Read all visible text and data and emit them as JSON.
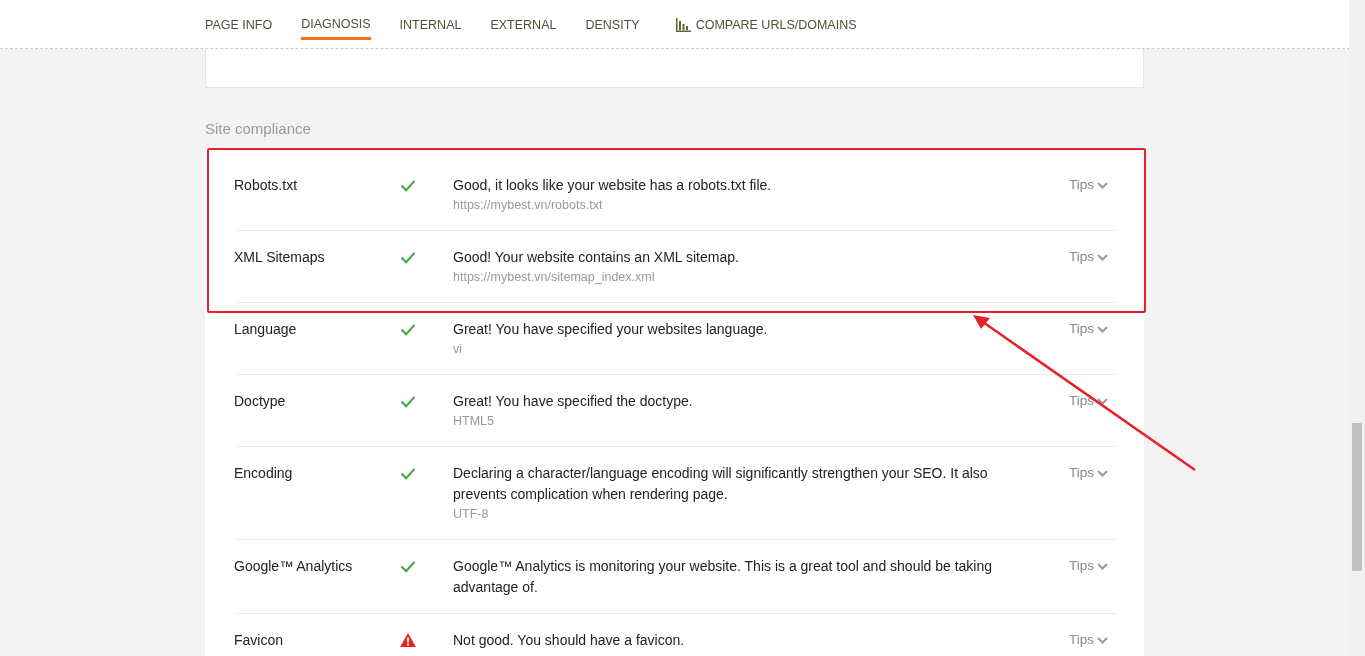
{
  "tabs": [
    {
      "label": "PAGE INFO",
      "selected": false
    },
    {
      "label": "DIAGNOSIS",
      "selected": true
    },
    {
      "label": "INTERNAL",
      "selected": false
    },
    {
      "label": "EXTERNAL",
      "selected": false
    },
    {
      "label": "DENSITY",
      "selected": false
    },
    {
      "label": "COMPARE URLS/DOMAINS",
      "selected": false,
      "kind": "chart"
    }
  ],
  "section": {
    "title": "Site compliance",
    "rows": [
      {
        "name": "Robots.txt",
        "kind": "pass",
        "message": "Good, it looks like your website has a robots.txt file.",
        "detail": "https://mybest.vn/robots.txt",
        "tips": "Tips"
      },
      {
        "name": "XML Sitemaps",
        "kind": "pass",
        "message": "Good! Your website contains an XML sitemap.",
        "detail": "https://mybest.vn/sitemap_index.xml",
        "tips": "Tips"
      },
      {
        "name": "Language",
        "kind": "pass",
        "message": "Great! You have specified your websites language.",
        "detail": "vi",
        "tips": "Tips"
      },
      {
        "name": "Doctype",
        "kind": "pass",
        "message": "Great! You have specified the doctype.",
        "detail": "HTML5",
        "tips": "Tips"
      },
      {
        "name": "Encoding",
        "kind": "pass",
        "message": "Declaring a character/language encoding will significantly strengthen your SEO. It also prevents complication when rendering page.",
        "detail": "UTF-8",
        "tips": "Tips"
      },
      {
        "name": "Google™ Analytics",
        "kind": "pass",
        "message": "Google™ Analytics is monitoring your website. This is a great tool and should be taking advantage of.",
        "tips": "Tips"
      },
      {
        "name": "Favicon",
        "kind": "fail",
        "message": "Not good. You should have a favicon.",
        "tips": "Tips"
      }
    ]
  }
}
